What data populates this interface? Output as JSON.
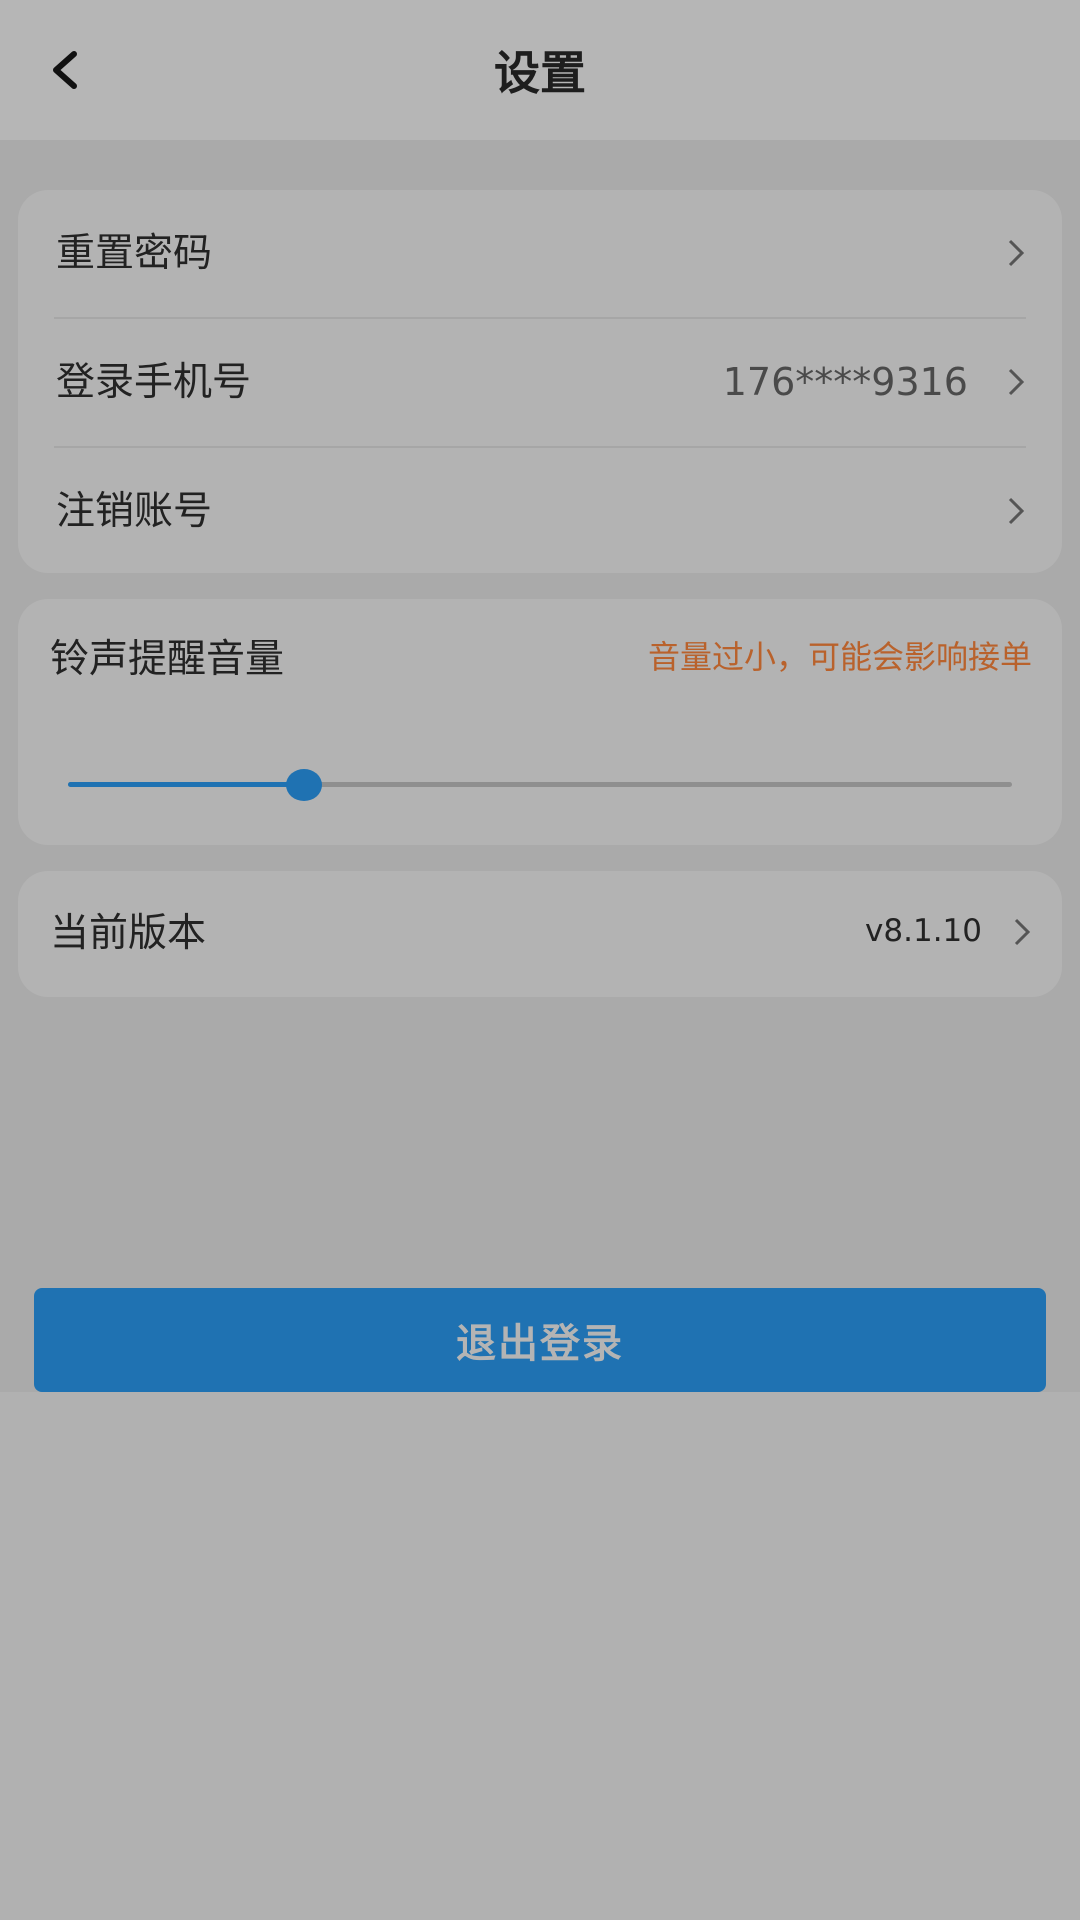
{
  "header": {
    "title": "设置",
    "back_icon": "chevron-left-icon"
  },
  "account_card": {
    "items": [
      {
        "label": "重置密码",
        "value": ""
      },
      {
        "label": "登录手机号",
        "value": "176****9316"
      },
      {
        "label": "注销账号",
        "value": ""
      }
    ]
  },
  "volume_card": {
    "label": "铃声提醒音量",
    "warning": "音量过小，可能会影响接单",
    "level": 0.25
  },
  "version_card": {
    "label": "当前版本",
    "value": "v8.1.10"
  },
  "logout_button": {
    "label": "退出登录"
  },
  "colors": {
    "accent": "#1f72b2",
    "warning": "#b9622c",
    "background": "#aaaaaa",
    "card": "#b3b3b3"
  }
}
